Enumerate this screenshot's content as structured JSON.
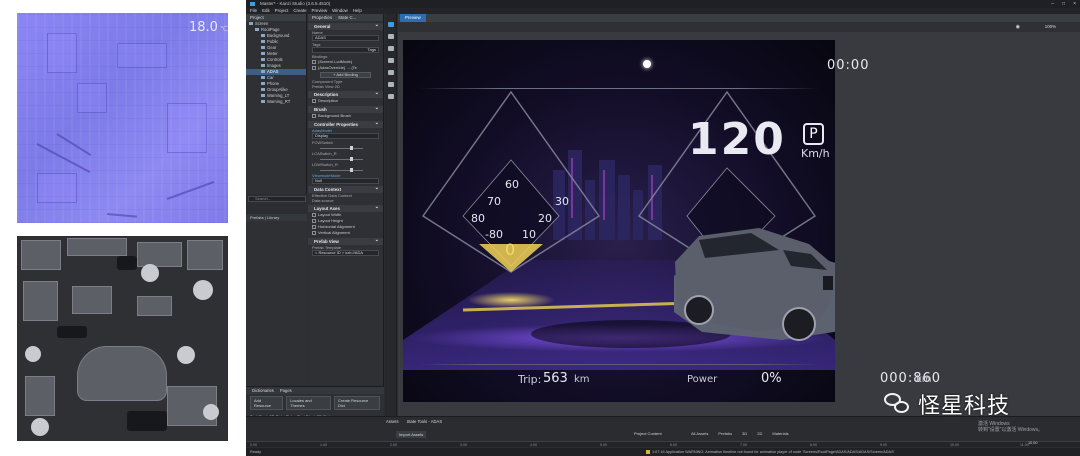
{
  "window": {
    "title": "Master* - Kanzi Studio (3.6.5.4510)",
    "menu": [
      "File",
      "Edit",
      "Project",
      "Create",
      "Preview",
      "Window",
      "Help"
    ]
  },
  "project_panel": {
    "tab": "Project",
    "tree": [
      {
        "label": "Screen",
        "indent": 0
      },
      {
        "label": "RootPage",
        "indent": 1
      },
      {
        "label": "Background",
        "indent": 2
      },
      {
        "label": "Public",
        "indent": 2
      },
      {
        "label": "Gear",
        "indent": 2
      },
      {
        "label": "Meter",
        "indent": 2
      },
      {
        "label": "Controls",
        "indent": 2
      },
      {
        "label": "Images",
        "indent": 2
      },
      {
        "label": "ADAS",
        "indent": 2,
        "selected": true
      },
      {
        "label": "Car",
        "indent": 2
      },
      {
        "label": "Phone",
        "indent": 2
      },
      {
        "label": "GroupAlike",
        "indent": 2
      },
      {
        "label": "Warning_LT",
        "indent": 2
      },
      {
        "label": "Warning_RT",
        "indent": 2
      }
    ],
    "search_placeholder": "Search...",
    "bottom_tabs": "Prefabs | Library"
  },
  "properties_panel": {
    "tabs": [
      "Properties",
      "State C..."
    ],
    "sections": {
      "general": "General",
      "name_label": "Name",
      "name_value": "ADAS",
      "tags_label": "Tags",
      "tags_button": "Tags",
      "bindings_label": "Bindings",
      "binding1": "{Screen/.LcdMode}",
      "binding2": "{AdasOverride} → {Te",
      "add_binding": "+ Add Binding",
      "component_type_label": "Component Type",
      "component_type_value": "Prefab View 2D",
      "description": "Description",
      "description_row": "Description",
      "brush": "Brush",
      "background_brush": "Background Brush",
      "controller": "Controller Properties",
      "adas_mode_label": "AdasModel",
      "adas_mode_value": "Display",
      "fcwswitch": "FCWSwitch",
      "lcaswitch": "LCASwitch_R",
      "ldwswitch": "LDWSwitch_R",
      "viewmode_label": "ViewmodeMode",
      "viewmode_value": "Null",
      "data_context": "Data Context",
      "effective_data_context": "Effective Data Context",
      "data_source": "Data source",
      "layout": "Layout Axes",
      "layout_width": "Layout Width",
      "layout_height": "Layout Height",
      "horizontal_alignment": "Horizontal Alignment",
      "vertical_alignment": "Vertical Alignment",
      "prefab_view": "Prefab View",
      "prefab_template_label": "Prefab Template",
      "prefab_template_value": "< Resource ID > kzb://ADA"
    }
  },
  "dock_bottom": {
    "tabs": [
      "Dictionaries",
      "Pages"
    ],
    "buttons": [
      "Add Resource",
      "Locales and Themes",
      "Create Resource Dict"
    ],
    "row": "Text Block 2D Style    Styles/Text Block 2D Style"
  },
  "preview": {
    "tab": "Preview",
    "zoom": "100%"
  },
  "dashboard": {
    "temperature": "18.0",
    "temperature_unit": "℃",
    "clock": "00:00",
    "speed": "120",
    "gear": "P",
    "speed_unit": "Km/h",
    "trip_label": "Trip:",
    "trip_value": "563",
    "trip_unit": "km",
    "power_label": "Power",
    "power_value": "0%",
    "odometer": "000:860",
    "odometer_unit": "km",
    "gauge_ticks": [
      "60",
      "70",
      "30",
      "80",
      "20",
      "-80",
      "10"
    ],
    "gauge_zero": "0",
    "colors": {
      "accent": "#f4d86a",
      "bg": "#120d26",
      "glow": "#7d4cff"
    }
  },
  "bottom_area": {
    "tabs": [
      "Assets",
      "State Tools - ADAS"
    ],
    "toolbar": [
      "Import Assets",
      "Search",
      "All Assets",
      "Prefabs",
      "3D",
      "2D",
      "Materials"
    ],
    "project_content": "Project Content",
    "timeline_ticks": [
      "0.00",
      "1.00",
      "2.00",
      "3.00",
      "4.00",
      "5.00",
      "6.00",
      "7.00",
      "8.00",
      "9.00",
      "10.00",
      "11.00"
    ],
    "status_ready": "Ready",
    "status_warning": "1:07:16 Application WARNING: Animation timeline not found for animation player of node 'Screens/RootPage/ADAS/ADAS/ADAS/Screen/ADAS'",
    "time_field": "10.00"
  },
  "watermark": {
    "text": "怪星科技",
    "activate_line1": "激活 Windows",
    "activate_line2": "转到“设置”以激活 Windows。"
  }
}
